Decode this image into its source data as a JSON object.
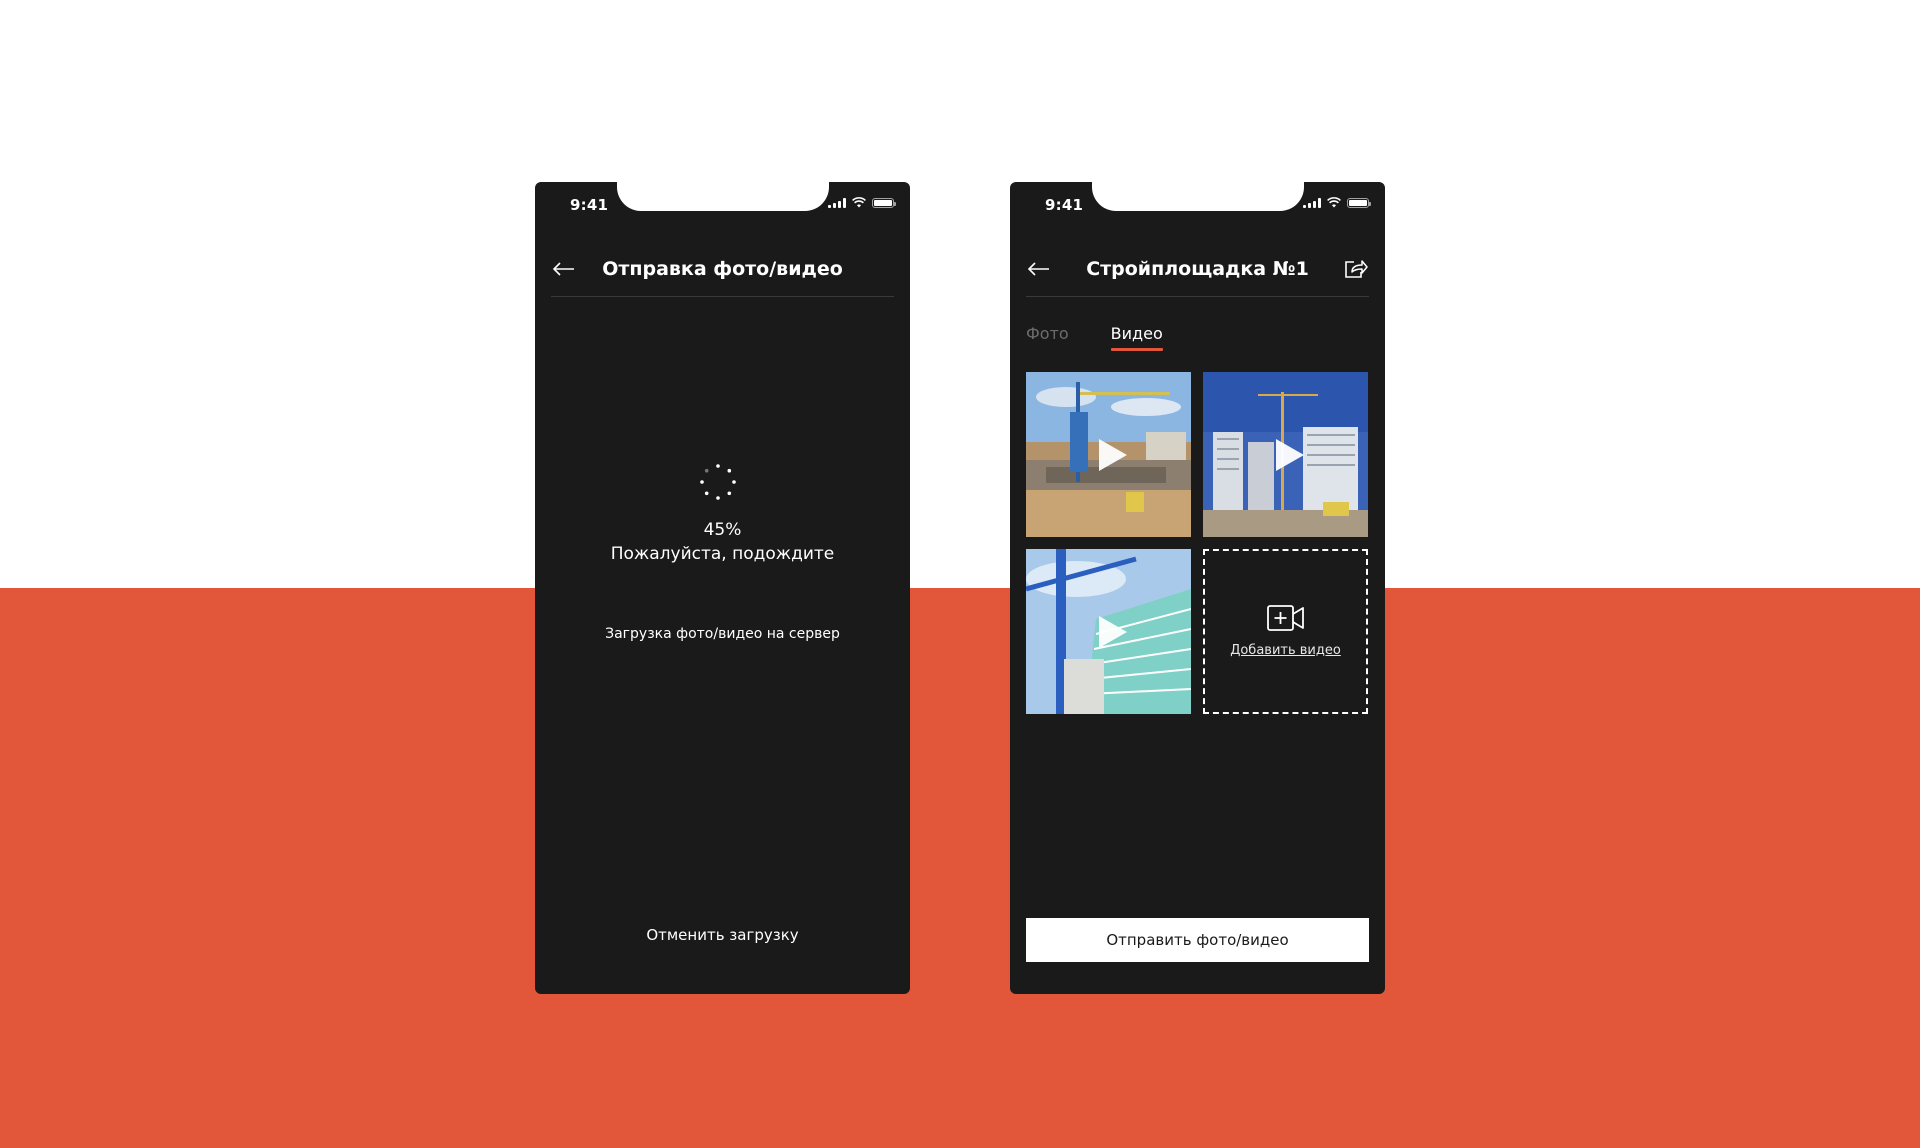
{
  "status_bar": {
    "time": "9:41"
  },
  "upload_screen": {
    "title": "Отправка фото/видео",
    "progress_percent": "45%",
    "progress_value": 45,
    "wait_text": "Пожалуйста, подождите",
    "description": "Загрузка фото/видео на сервер",
    "cancel_label": "Отменить загрузку"
  },
  "gallery_screen": {
    "title": "Стройплощадка №1",
    "tabs": [
      {
        "label": "Фото",
        "active": false
      },
      {
        "label": "Видео",
        "active": true
      }
    ],
    "videos": [
      {
        "icon": "play-icon"
      },
      {
        "icon": "play-icon"
      },
      {
        "icon": "play-icon"
      }
    ],
    "add_video_label": "Добавить видео",
    "send_label": "Отправить фото/видео"
  },
  "colors": {
    "accent": "#e2573a",
    "phone_bg": "#1a1a1a",
    "page_bg": "#ffffff"
  }
}
